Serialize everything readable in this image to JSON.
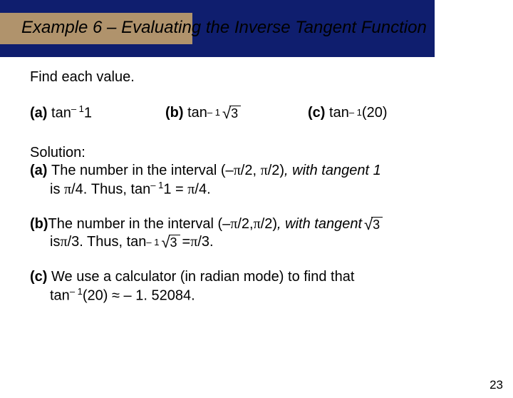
{
  "title": "Example 6 – Evaluating the Inverse Tangent Function",
  "prompt": "Find each value.",
  "problems": {
    "a_label": "(a)",
    "a_func": "tan",
    "a_exp": "– 1",
    "a_arg": "1",
    "b_label": "(b)",
    "b_func": "tan",
    "b_exp": "– 1",
    "b_sqrt": "3",
    "c_label": "(c)",
    "c_func": "tan",
    "c_exp": "– 1",
    "c_arg": "(20)"
  },
  "solution": {
    "heading": "Solution:",
    "a1_lead": "(a) ",
    "a1_text1": "The number in the interval (–",
    "a1_pi1": "π",
    "a1_text2": "/2, ",
    "a1_pi2": "π",
    "a1_text3": "/2)",
    "a1_close": ", with tangent 1",
    "a2_text1": "is ",
    "a2_pi1": "π",
    "a2_text2": "/4. Thus, tan",
    "a2_exp": "– 1",
    "a2_text3": "1 = ",
    "a2_pi2": "π",
    "a2_text4": "/4.",
    "b1_lead": "(b) ",
    "b1_text1": "The number in the interval (–",
    "b1_pi1": "π",
    "b1_text2": "/2, ",
    "b1_pi2": "π",
    "b1_text3": "/2)",
    "b1_close": ", with tangent ",
    "b1_sqrt": "3",
    "b2_text1": "is ",
    "b2_pi1": "π",
    "b2_text2": "/3. Thus, tan",
    "b2_exp": "– 1",
    "b2_sqrt": "3",
    "b2_text3": " = ",
    "b2_pi2": "π",
    "b2_text4": "/3.",
    "c1_lead": "(c) ",
    "c1_text": "We use a calculator (in radian mode) to find that",
    "c2_text1": "tan",
    "c2_exp": "– 1",
    "c2_text2": "(20) ",
    "c2_approx": "≈",
    "c2_text3": " – 1. 52084."
  },
  "page_number": "23"
}
